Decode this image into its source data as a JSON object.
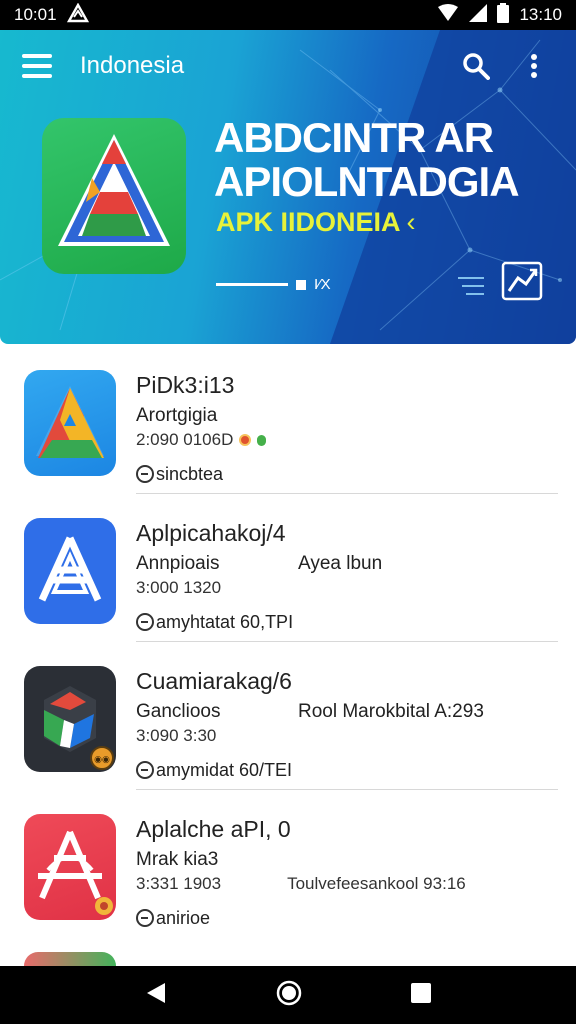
{
  "status_bar": {
    "time_left": "10:01",
    "time_right": "13:10"
  },
  "toolbar": {
    "title": "Indonesia"
  },
  "banner": {
    "title_line1": "ABDCINTR AR",
    "title_line2": "APIOLNTADGIA",
    "subtitle": "APK IIDONEIA",
    "subtitle_chevron": "‹",
    "indicator_text": "I⁄X"
  },
  "apps": [
    {
      "name": "PiDk3:i13",
      "line1": "Arortgigia",
      "line1_right": "",
      "meta": "2:090  0106D",
      "tag": "sincbtea"
    },
    {
      "name": "Aplpicahakoj/4",
      "line1": "Annpioais",
      "line1_right": "Ayea lbun",
      "meta": "3:000   1320",
      "tag": "amyhtatat 60,TPI"
    },
    {
      "name": "Cuamiarakag/6",
      "line1": "Ganclioos",
      "line1_right": "Rool Marokbital A:293",
      "meta": "3:090   3:30",
      "tag": "amymidat 60/TEI"
    },
    {
      "name": "Aplalche aPI, 0",
      "line1": "Mrak kia3",
      "line1_right": "Toulvefeesankool 93:16",
      "meta": "3:331   1903",
      "tag": "anirioe"
    }
  ],
  "colors": {
    "header_start": "#17b9cf",
    "header_end": "#123f9c",
    "accent_yellow": "#e7f23a"
  }
}
